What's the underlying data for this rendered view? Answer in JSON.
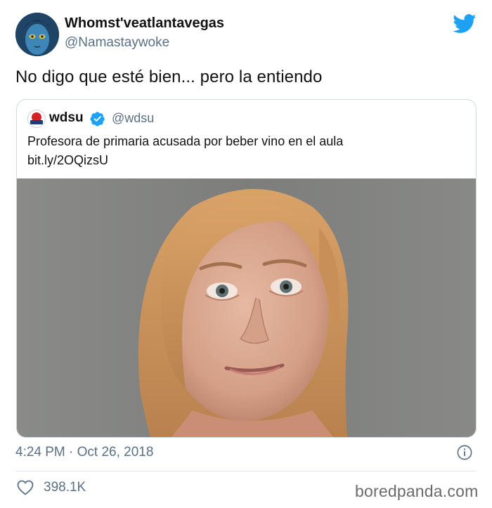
{
  "author": {
    "display_name": "Whomst'veatlantavegas",
    "handle": "@Namastaywoke"
  },
  "tweet": {
    "text": "No digo que esté bien... pero la entiendo"
  },
  "quoted_tweet": {
    "display_name": "wdsu",
    "handle": "@wdsu",
    "text": "Profesora de primaria acusada por beber vino en el aula",
    "link": "bit.ly/2OQizsU"
  },
  "meta": {
    "timestamp": "4:24 PM · Oct 26, 2018",
    "likes": "398.1K"
  },
  "icons": {
    "brand": "twitter-bird-icon",
    "verified": "verified-badge-icon",
    "info": "info-icon",
    "like": "heart-icon"
  },
  "colors": {
    "twitter_blue": "#1da1f2",
    "secondary_text": "#5b7083"
  },
  "watermark": "boredpanda.com"
}
